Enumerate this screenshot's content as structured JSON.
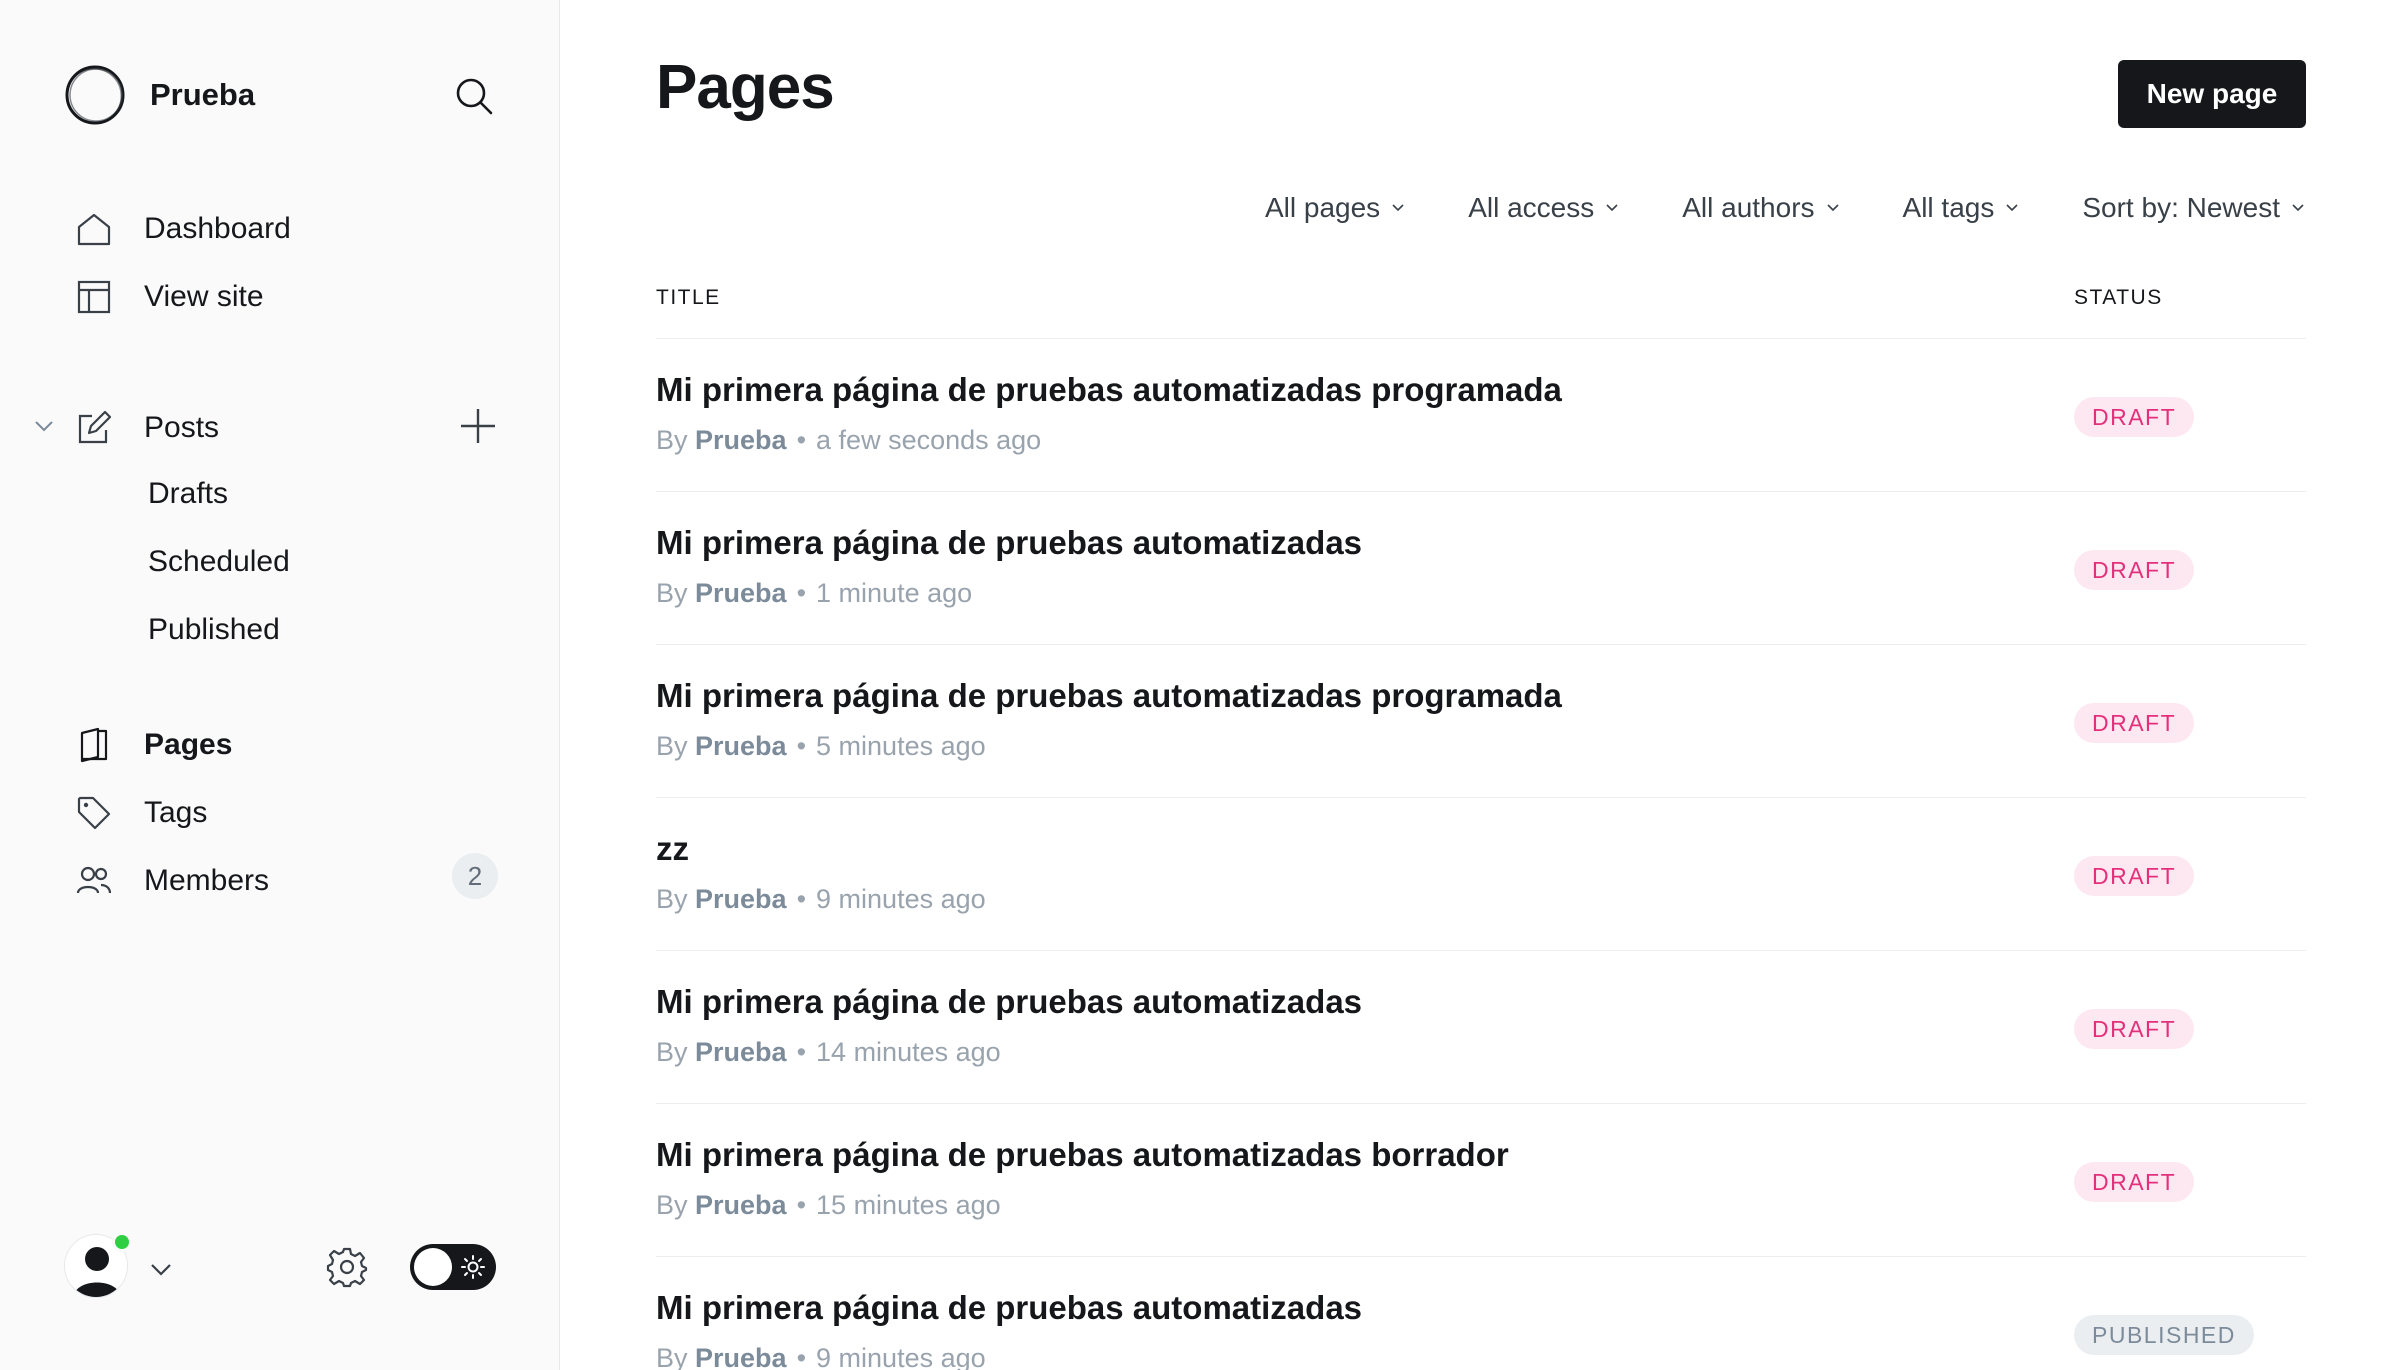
{
  "sidebar": {
    "brand": "Prueba",
    "nav": {
      "dashboard": "Dashboard",
      "view_site": "View site",
      "posts": "Posts",
      "drafts": "Drafts",
      "scheduled": "Scheduled",
      "published": "Published",
      "pages": "Pages",
      "tags": "Tags",
      "members": "Members",
      "members_count": "2"
    },
    "icons": [
      "search-icon",
      "home-icon",
      "layout-icon",
      "edit-icon",
      "plus-icon",
      "chevron-down-icon",
      "page-icon",
      "tag-icon",
      "members-icon",
      "gear-icon",
      "sun-icon"
    ],
    "status_color": "#30cf43"
  },
  "header": {
    "title": "Pages",
    "new_button": "New page"
  },
  "filters": {
    "pages": "All pages",
    "access": "All access",
    "authors": "All authors",
    "tags": "All tags",
    "sort": "Sort by: Newest"
  },
  "table": {
    "col_title": "TITLE",
    "col_status": "STATUS",
    "rows": [
      {
        "title": "Mi primera página de pruebas automatizadas programada",
        "by": "By",
        "author": "Prueba",
        "sep": "•",
        "time": "a few seconds ago",
        "status": "DRAFT"
      },
      {
        "title": "Mi primera página de pruebas automatizadas",
        "by": "By",
        "author": "Prueba",
        "sep": "•",
        "time": "1 minute ago",
        "status": "DRAFT"
      },
      {
        "title": "Mi primera página de pruebas automatizadas programada",
        "by": "By",
        "author": "Prueba",
        "sep": "•",
        "time": "5 minutes ago",
        "status": "DRAFT"
      },
      {
        "title": "zz",
        "by": "By",
        "author": "Prueba",
        "sep": "•",
        "time": "9 minutes ago",
        "status": "DRAFT"
      },
      {
        "title": "Mi primera página de pruebas automatizadas",
        "by": "By",
        "author": "Prueba",
        "sep": "•",
        "time": "14 minutes ago",
        "status": "DRAFT"
      },
      {
        "title": "Mi primera página de pruebas automatizadas borrador",
        "by": "By",
        "author": "Prueba",
        "sep": "•",
        "time": "15 minutes ago",
        "status": "DRAFT"
      },
      {
        "title": "Mi primera página de pruebas automatizadas",
        "by": "By",
        "author": "Prueba",
        "sep": "•",
        "time": "9 minutes ago",
        "status": "PUBLISHED"
      }
    ]
  },
  "colors": {
    "draft_text": "#e42f7b",
    "draft_bg": "#fde8f1",
    "published_text": "#7c8b9a",
    "published_bg": "#ebeef0",
    "primary_button": "#15171a"
  }
}
